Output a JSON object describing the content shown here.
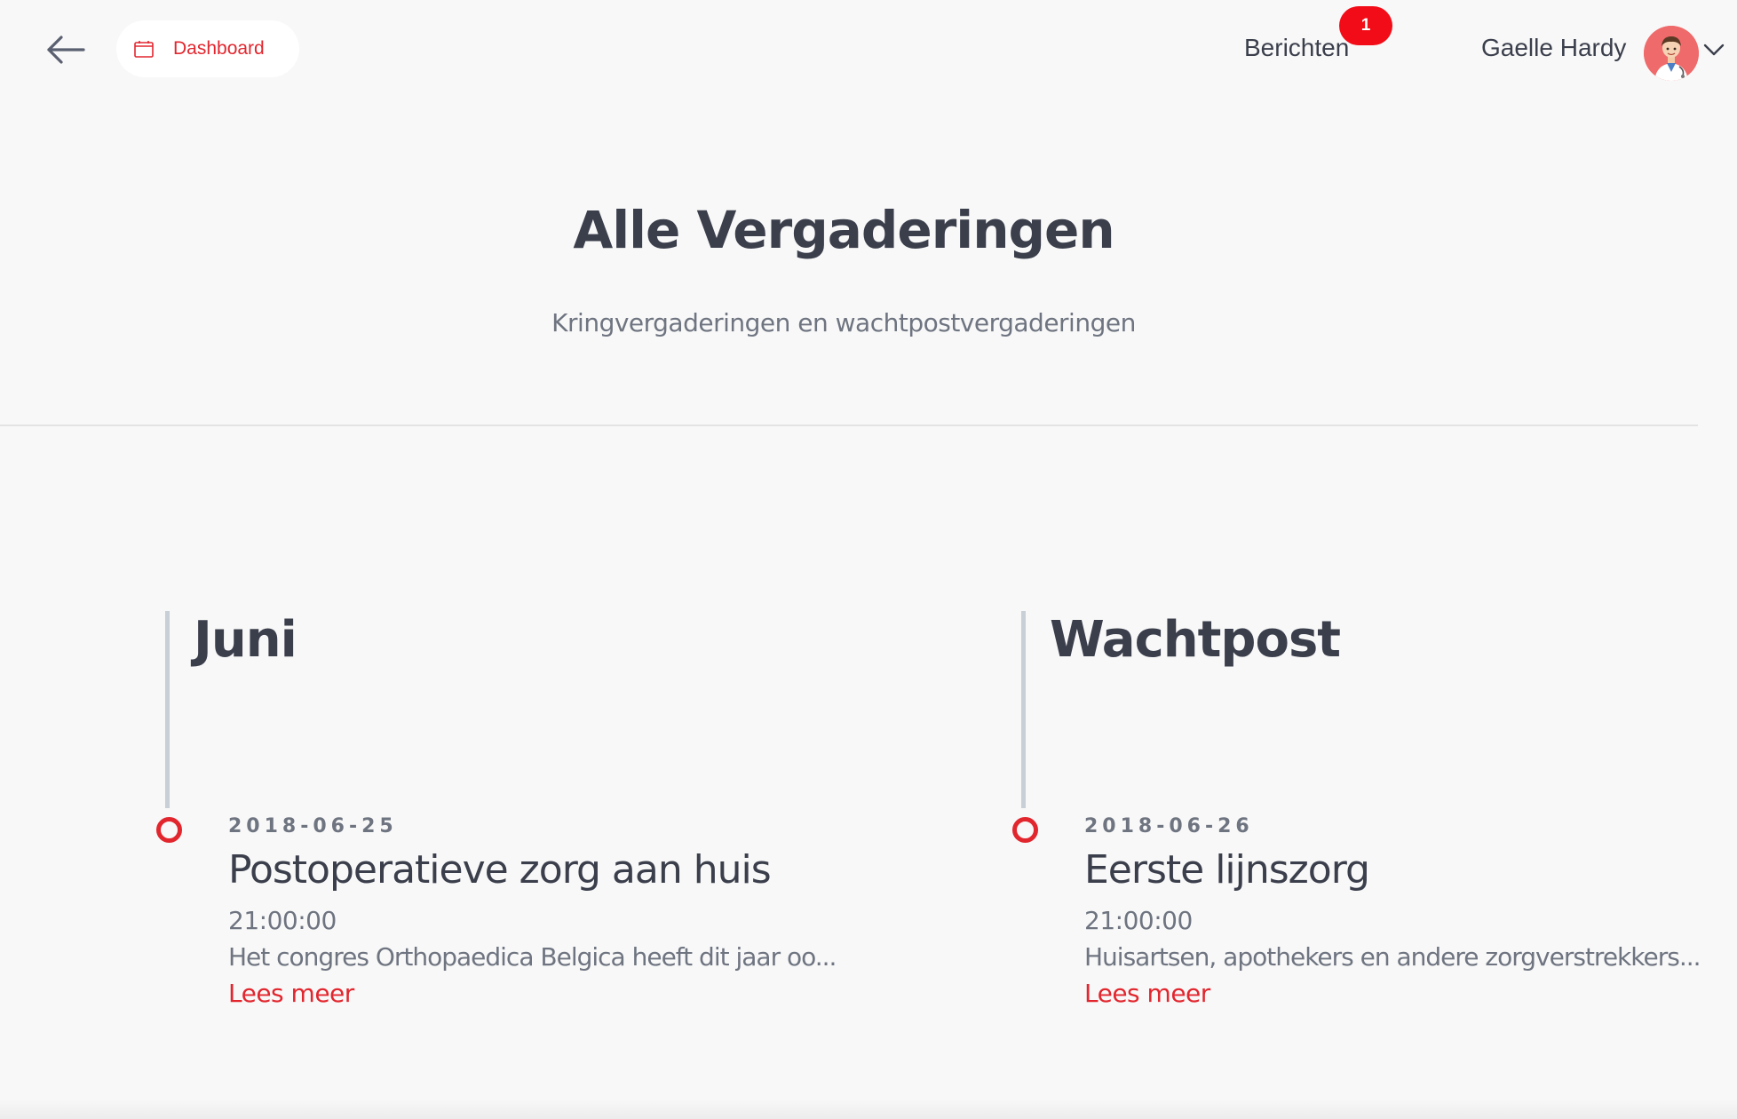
{
  "topbar": {
    "back_icon": "arrow-left-icon",
    "dashboard": {
      "label": "Dashboard",
      "icon": "calendar-icon"
    },
    "messages": {
      "label": "Berichten",
      "badge_count": "1"
    },
    "user": {
      "name": "Gaelle Hardy",
      "avatar_icon": "doctor-avatar",
      "menu_icon": "chevron-down-icon"
    }
  },
  "hero": {
    "title": "Alle Vergaderingen",
    "subtitle": "Kringvergaderingen en wachtpostvergaderingen"
  },
  "columns": [
    {
      "heading": "Juni",
      "event": {
        "date": "2018-06-25",
        "title": "Postoperatieve zorg aan huis",
        "time": "21:00:00",
        "description": "Het congres Orthopaedica Belgica heeft dit jaar oo...",
        "link": "Lees meer"
      }
    },
    {
      "heading": "Wachtpost",
      "event": {
        "date": "2018-06-26",
        "title": "Eerste lijnszorg",
        "time": "21:00:00",
        "description": "Huisartsen, apothekers en andere zorgverstrekkers...",
        "link": "Lees meer"
      }
    }
  ],
  "colors": {
    "accent": "#e2262e",
    "badge": "#f20c17",
    "text_dark": "#3b3f4c",
    "text_muted": "#6e7480",
    "background": "#f8f8f8",
    "timeline_line": "#c9cfd6"
  }
}
